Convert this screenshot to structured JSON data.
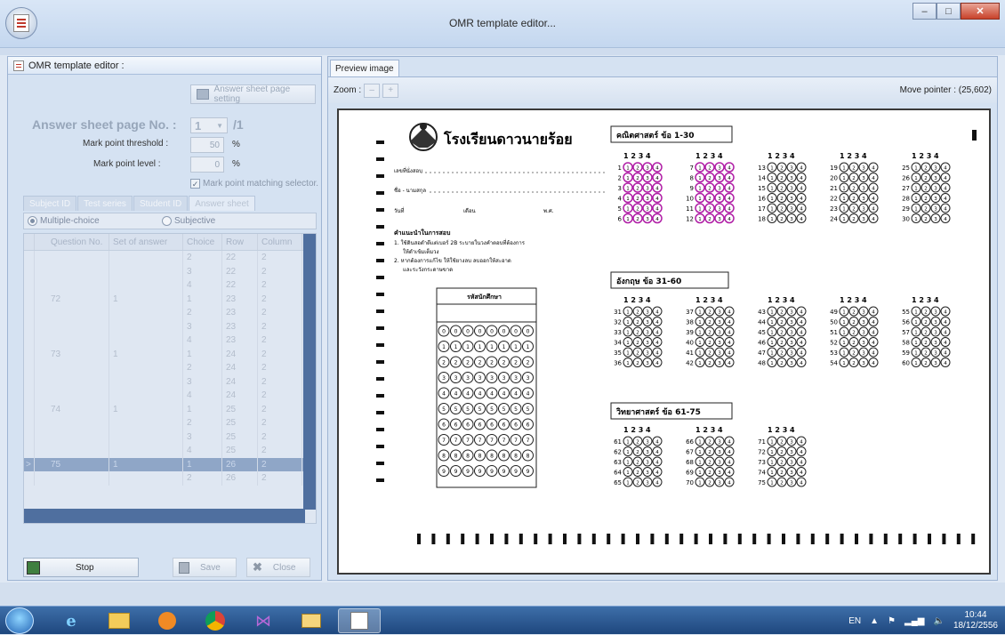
{
  "window": {
    "title": "OMR template editor...",
    "min": "–",
    "max": "□",
    "close": "✕"
  },
  "left": {
    "panel_title": "OMR template editor :",
    "page_setting_label": "Answer sheet page setting",
    "page_no_label": "Answer sheet page No. :",
    "page_no_value": "1",
    "page_total": "/1",
    "threshold_label": "Mark point threshold :",
    "threshold_value": "50",
    "threshold_unit": "%",
    "level_label": "Mark point level :",
    "level_value": "0",
    "level_unit": "%",
    "matching_label": "Mark point matching selector.",
    "tabs": [
      "Subject ID",
      "Test series",
      "Student ID",
      "Answer sheet"
    ],
    "radio_multiple": "Multiple-choice",
    "radio_subjective": "Subjective",
    "columns": [
      "Question No.",
      "Set of answer",
      "Choice",
      "Row",
      "Column"
    ],
    "rows": [
      [
        "",
        "",
        "2",
        "22",
        "2"
      ],
      [
        "",
        "",
        "3",
        "22",
        "2"
      ],
      [
        "",
        "",
        "4",
        "22",
        "2"
      ],
      [
        "72",
        "1",
        "1",
        "23",
        "2"
      ],
      [
        "",
        "",
        "2",
        "23",
        "2"
      ],
      [
        "",
        "",
        "3",
        "23",
        "2"
      ],
      [
        "",
        "",
        "4",
        "23",
        "2"
      ],
      [
        "73",
        "1",
        "1",
        "24",
        "2"
      ],
      [
        "",
        "",
        "2",
        "24",
        "2"
      ],
      [
        "",
        "",
        "3",
        "24",
        "2"
      ],
      [
        "",
        "",
        "4",
        "24",
        "2"
      ],
      [
        "74",
        "1",
        "1",
        "25",
        "2"
      ],
      [
        "",
        "",
        "2",
        "25",
        "2"
      ],
      [
        "",
        "",
        "3",
        "25",
        "2"
      ],
      [
        "",
        "",
        "4",
        "25",
        "2"
      ],
      [
        "75",
        "1",
        "1",
        "26",
        "2"
      ],
      [
        "",
        "",
        "2",
        "26",
        "2"
      ]
    ],
    "selected_row_marker": ">",
    "stop_label": "Stop",
    "save_label": "Save",
    "close_label": "Close"
  },
  "right": {
    "tab": "Preview image",
    "zoom_label": "Zoom :",
    "zoom_out": "–",
    "zoom_in": "+",
    "pointer_text": "Move pointer : (25,602)"
  },
  "sheet": {
    "school": "โรงเรียนดาวนายร้อย",
    "sec1": "คณิตศาสตร์ ข้อ 1-30",
    "sec2": "อังกฤษ ข้อ 31-60",
    "sec3": "วิทยาศาสตร์ ข้อ 61-75",
    "line1": "เลขที่นั่งสอบ",
    "line2": "ชื่อ - นามสกุล",
    "line3": "วันที่",
    "line3b": "เดือน",
    "line3c": "พ.ศ.",
    "instr_title": "คำแนะนำในการสอบ",
    "instr1": "1. ใช้ดินสอดำดีแต่เบอร์ 2B ระบายในวงคำตอบที่ต้องการ",
    "instr1b": "ให้ดำเข้มเต็มวง",
    "instr2": "2. หากต้องการแก้ไข ให้ใช้ยางลบ ลบออกให้สะอาด",
    "instr2b": "และระวังกระดาษขาด",
    "sid_title": "รหัสนักศึกษา",
    "choice_header": "1 2 3 4"
  },
  "taskbar": {
    "lang": "EN",
    "time": "10:44",
    "date": "18/12/2556"
  }
}
